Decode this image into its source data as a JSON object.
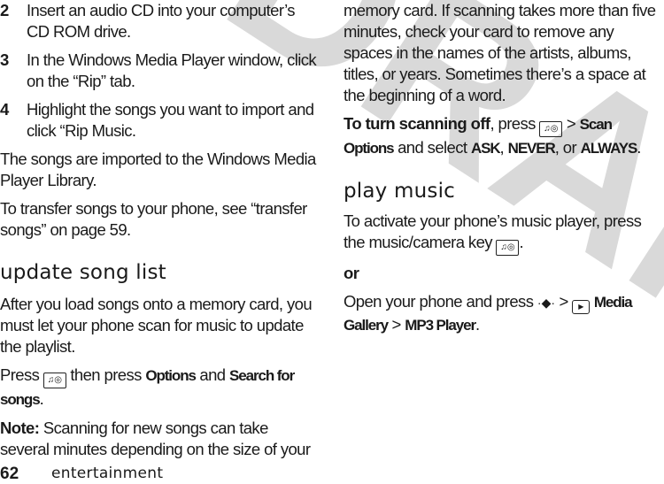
{
  "watermark": {
    "text": "DRAFT",
    "color": "#d9d9d9"
  },
  "left": {
    "steps": [
      {
        "num": "2",
        "text": "Insert an audio CD into your computer’s CD ROM drive."
      },
      {
        "num": "3",
        "text": "In the Windows Media Player window, click on the “Rip” tab."
      },
      {
        "num": "4",
        "text": "Highlight the songs you want to import and click “Rip Music."
      }
    ],
    "para1": "The songs are imported to the Windows Media Player Library.",
    "para2": "To transfer songs to your phone, see “transfer songs” on page 59.",
    "heading": "update song list",
    "para3": "After you load songs onto a memory card, you must let your phone scan for music to update the playlist.",
    "press": {
      "pre": "Press",
      "mid": "then press",
      "opt": "Options",
      "and": "and",
      "search": "Search for songs",
      "end": "."
    },
    "note": {
      "label": "Note:",
      "text": "Scanning for new songs can take several minutes depending on the size of your"
    }
  },
  "right": {
    "para1": "memory card. If scanning takes more than five minutes, check your card to remove any spaces in the names of the artists, albums, titles, or years. Sometimes there’s a space at the beginning of a word.",
    "scan": {
      "bold": "To turn scanning off",
      "press": ", press",
      "gt": ">",
      "opt": "Scan Options",
      "select": "and select",
      "ask": "ASK",
      "comma": ",",
      "never": "NEVER",
      "or": ", or",
      "always": "ALWAYS",
      "end": "."
    },
    "heading": "play music",
    "para2": "To activate your phone’s music player, press the music/camera key",
    "para2_end": ".",
    "or": "or",
    "open": {
      "pre": "Open your phone and press",
      "gt1": ">",
      "media": "Media Gallery",
      "gt2": ">",
      "mp3": "MP3 Player",
      "end": "."
    }
  },
  "icons": {
    "music_camera_key": "♫◎",
    "nav_key": "·◆·",
    "media_icon": "▶"
  },
  "footer": {
    "page_number": "62",
    "section": "entertainment"
  }
}
